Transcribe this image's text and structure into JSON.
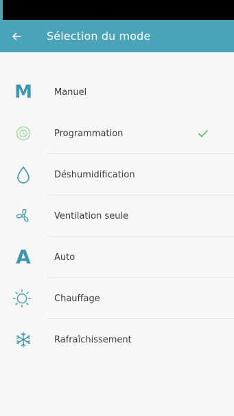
{
  "colors": {
    "status_bar": "#000000",
    "app_bar": "#4aa3b8",
    "icon": "#3b95ad",
    "check": "#4fc04f",
    "text": "#3b3b3b",
    "background": "#f7f7f7"
  },
  "header": {
    "back_icon": "arrow-left-icon",
    "title": "Sélection du mode"
  },
  "modes": [
    {
      "label": "Manuel",
      "icon": "letter-m-icon",
      "selected": false
    },
    {
      "label": "Programmation",
      "icon": "clock-icon",
      "selected": true
    },
    {
      "label": "Déshumidification",
      "icon": "water-drop-icon",
      "selected": false
    },
    {
      "label": "Ventilation seule",
      "icon": "fan-icon",
      "selected": false
    },
    {
      "label": "Auto",
      "icon": "letter-a-icon",
      "selected": false
    },
    {
      "label": "Chauffage",
      "icon": "sun-icon",
      "selected": false
    },
    {
      "label": "Rafraîchissement",
      "icon": "snowflake-icon",
      "selected": false
    }
  ]
}
